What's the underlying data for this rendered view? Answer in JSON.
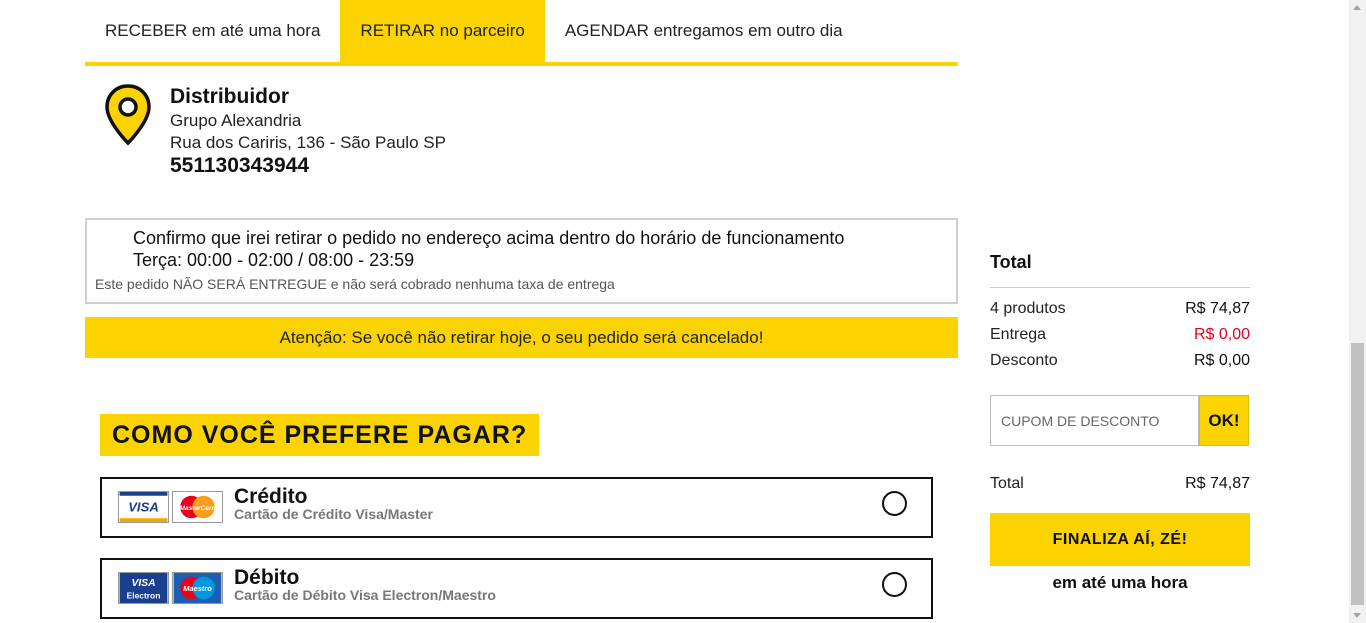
{
  "delivery_tabs": [
    {
      "label": "RECEBER em até uma hora",
      "active": false
    },
    {
      "label": "RETIRAR no parceiro",
      "active": true
    },
    {
      "label": "AGENDAR entregamos em outro dia",
      "active": false
    }
  ],
  "distributor": {
    "title": "Distribuidor",
    "name": "Grupo Alexandria",
    "address": "Rua dos Cariris, 136 - São Paulo SP",
    "phone": "551130343944",
    "icon": "location-pin-icon"
  },
  "pickup_confirmation": {
    "line1": "Confirmo que irei retirar o pedido no endereço acima dentro do horário de funcionamento",
    "line2": "Terça: 00:00 - 02:00 / 08:00 - 23:59",
    "note": "Este pedido NÃO SERÁ ENTREGUE e não será cobrado nenhuma taxa de entrega"
  },
  "warning": "Atenção: Se você não retirar hoje, o seu pedido será cancelado!",
  "payment": {
    "heading": "COMO VOCÊ PREFERE PAGAR?",
    "options": [
      {
        "title": "Crédito",
        "subtitle": "Cartão de Crédito Visa/Master",
        "logos": [
          "VISA",
          "MasterCard"
        ]
      },
      {
        "title": "Débito",
        "subtitle": "Cartão de Débito Visa Electron/Maestro",
        "logos": [
          "VISA Electron",
          "Maestro"
        ]
      }
    ]
  },
  "summary": {
    "title": "Total",
    "products_label": "4 produtos",
    "products_value": "R$ 74,87",
    "delivery_label": "Entrega",
    "delivery_value": "R$ 0,00",
    "discount_label": "Desconto",
    "discount_value": "R$ 0,00",
    "coupon_placeholder": "CUPOM DE DESCONTO",
    "ok_label": "OK!",
    "total_label": "Total",
    "total_value": "R$ 74,87",
    "finish_label": "FINALIZA AÍ, ZÉ!",
    "finish_sub": "em até uma hora"
  },
  "colors": {
    "accent": "#fad300",
    "negative": "#e8001c"
  }
}
